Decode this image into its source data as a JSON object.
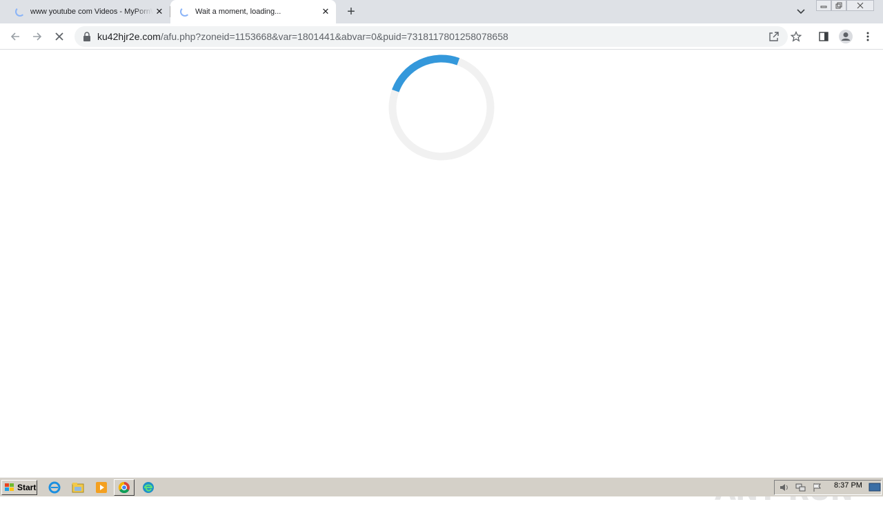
{
  "browser": {
    "tabs": [
      {
        "title": "www youtube com Videos - MyPornW",
        "active": false
      },
      {
        "title": "Wait a moment, loading...",
        "active": true
      }
    ],
    "new_tab_label": "+",
    "url": {
      "host": "ku42hjr2e.com",
      "path": "/afu.php?zoneid=1153668&var=1801441&abvar=0&puid=7318117801258078658"
    }
  },
  "page": {
    "loader_progress": 0.25,
    "accent_color": "#3498db"
  },
  "watermark": {
    "left": "ANY",
    "right": "RUN"
  },
  "taskbar": {
    "start_label": "Start",
    "clock": "8:37 PM",
    "apps": [
      "internet-explorer-icon",
      "file-explorer-icon",
      "media-player-icon",
      "chrome-icon",
      "edge-icon"
    ]
  }
}
